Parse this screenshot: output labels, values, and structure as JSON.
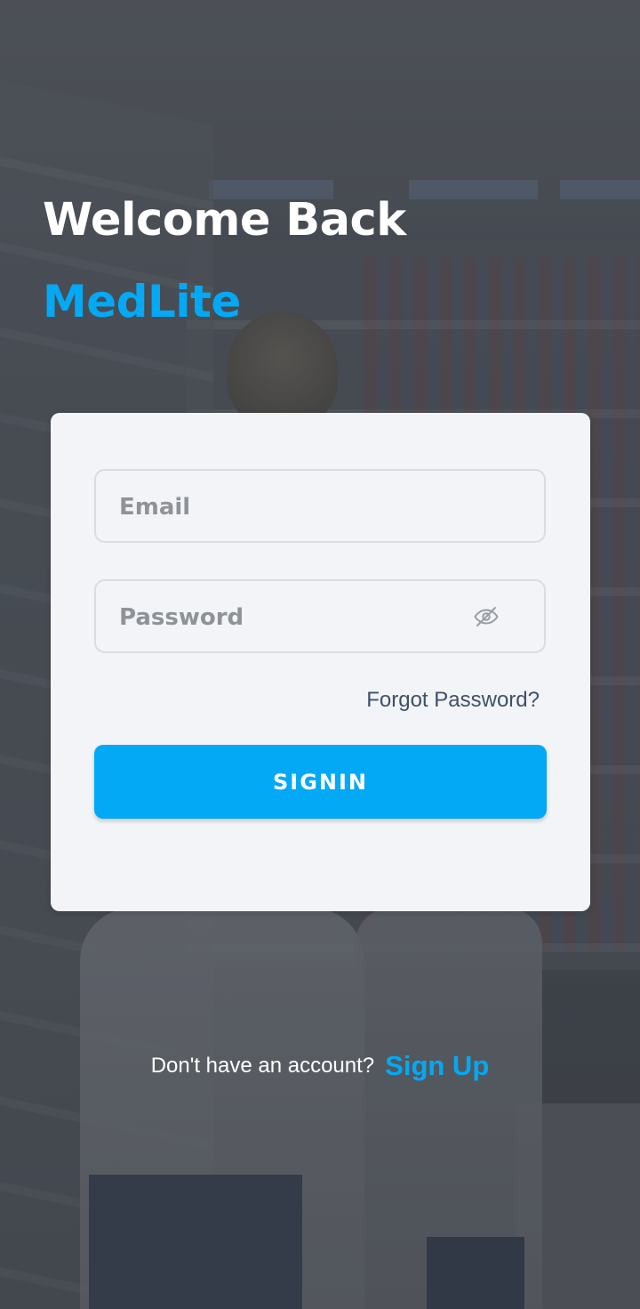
{
  "colors": {
    "accent": "#03a9f4",
    "title_text": "#ffffff",
    "card_bg": "#f2f4f7",
    "link_text": "#3f5068"
  },
  "header": {
    "welcome": "Welcome Back",
    "brand": "MedLite"
  },
  "form": {
    "email_placeholder": "Email",
    "password_placeholder": "Password",
    "password_toggle_icon": "eye-off-icon",
    "forgot_label": "Forgot Password?",
    "signin_label": "SIGNIN"
  },
  "footer": {
    "question": "Don't have an account?",
    "signup_label": "Sign Up"
  }
}
